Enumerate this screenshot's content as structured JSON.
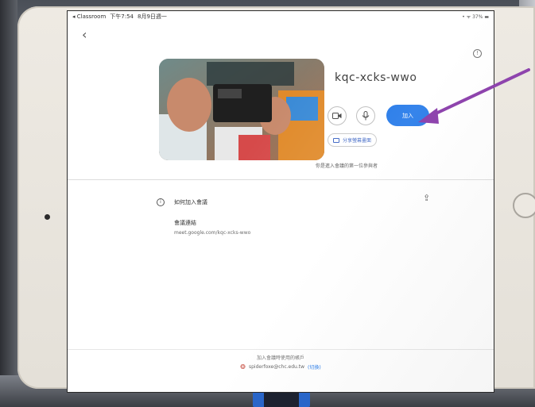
{
  "status_bar": {
    "back_app": "◂ Classroom",
    "time": "下午7:54",
    "date": "8月9日週一",
    "right": "• ᯤ 37% ▬"
  },
  "meeting": {
    "code": "kqc-xcks-wwo",
    "join_label": "加入",
    "share_screen_label": "分享螢幕畫面",
    "first_joiner_text": "你是進入會議的第一位參與者"
  },
  "howto": {
    "title": "如何加入會議",
    "link_label": "會議連結",
    "link_url": "meet.google.com/kqc-xcks-wwo"
  },
  "footer": {
    "text": "加入會議時使用的帳戶",
    "account": "spiderfoxe@chc.edu.tw",
    "switch_label": "(切換)"
  },
  "icons": {
    "back": "chevron-left-icon",
    "info": "info-icon",
    "camera": "camera-icon",
    "mic": "microphone-icon",
    "share": "share-icon",
    "annotation": "purple-arrow"
  },
  "colors": {
    "join_button": "#1a73e8",
    "annotation_arrow": "#8e44ad",
    "device_frame": "#e8e4dc"
  }
}
